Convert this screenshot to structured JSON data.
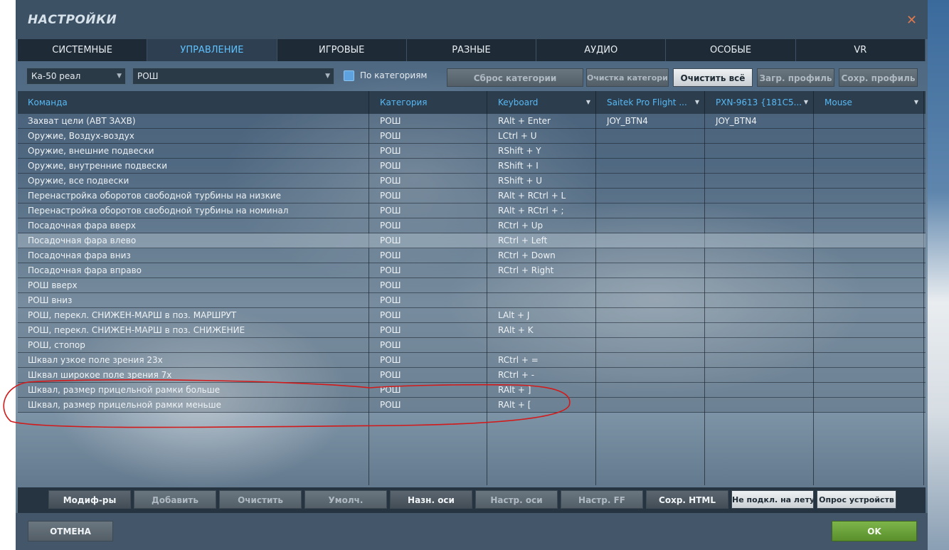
{
  "window": {
    "title": "НАСТРОЙКИ"
  },
  "tabs": [
    "СИСТЕМНЫЕ",
    "УПРАВЛЕНИЕ",
    "ИГРОВЫЕ",
    "РАЗНЫЕ",
    "АУДИО",
    "ОСОБЫЕ",
    "VR"
  ],
  "active_tab": "УПРАВЛЕНИЕ",
  "toolbar": {
    "aircraft_select": "Ка-50 реал",
    "category_select": "РОШ",
    "by_category_label": "По категориям",
    "by_category_checked": true,
    "reset_category": "Сброс категории",
    "clear_category": "Очистка категории",
    "clear_all": "Очистить всё",
    "load_profile": "Загр. профиль",
    "save_profile": "Сохр. профиль"
  },
  "table": {
    "columns": [
      "Команда",
      "Категория",
      "Keyboard",
      "Saitek Pro Flight ...",
      "PXN-9613 {181C5...",
      "Mouse"
    ],
    "rows": [
      {
        "command": "Захват цели (АВТ ЗАХВ)",
        "category": "РОШ",
        "keyboard": "RAlt + Enter",
        "saitek": "JOY_BTN4",
        "pxn": "JOY_BTN4",
        "mouse": ""
      },
      {
        "command": "Оружие, Воздух-воздух",
        "category": "РОШ",
        "keyboard": "LCtrl + U",
        "saitek": "",
        "pxn": "",
        "mouse": ""
      },
      {
        "command": "Оружие, внешние подвески",
        "category": "РОШ",
        "keyboard": "RShift + Y",
        "saitek": "",
        "pxn": "",
        "mouse": ""
      },
      {
        "command": "Оружие, внутренние подвески",
        "category": "РОШ",
        "keyboard": "RShift + I",
        "saitek": "",
        "pxn": "",
        "mouse": ""
      },
      {
        "command": "Оружие, все подвески",
        "category": "РОШ",
        "keyboard": "RShift + U",
        "saitek": "",
        "pxn": "",
        "mouse": ""
      },
      {
        "command": "Перенастройка оборотов свободной турбины на низкие",
        "category": "РОШ",
        "keyboard": "RAlt + RCtrl + L",
        "saitek": "",
        "pxn": "",
        "mouse": ""
      },
      {
        "command": "Перенастройка оборотов свободной турбины на номинал",
        "category": "РОШ",
        "keyboard": "RAlt + RCtrl + ;",
        "saitek": "",
        "pxn": "",
        "mouse": ""
      },
      {
        "command": "Посадочная фара вверх",
        "category": "РОШ",
        "keyboard": "RCtrl + Up",
        "saitek": "",
        "pxn": "",
        "mouse": ""
      },
      {
        "command": "Посадочная фара влево",
        "category": "РОШ",
        "keyboard": "RCtrl + Left",
        "saitek": "",
        "pxn": "",
        "mouse": ""
      },
      {
        "command": "Посадочная фара вниз",
        "category": "РОШ",
        "keyboard": "RCtrl + Down",
        "saitek": "",
        "pxn": "",
        "mouse": ""
      },
      {
        "command": "Посадочная фара вправо",
        "category": "РОШ",
        "keyboard": "RCtrl + Right",
        "saitek": "",
        "pxn": "",
        "mouse": ""
      },
      {
        "command": "РОШ вверх",
        "category": "РОШ",
        "keyboard": "",
        "saitek": "",
        "pxn": "",
        "mouse": ""
      },
      {
        "command": "РОШ вниз",
        "category": "РОШ",
        "keyboard": "",
        "saitek": "",
        "pxn": "",
        "mouse": ""
      },
      {
        "command": "РОШ, перекл. СНИЖЕН-МАРШ в поз. МАРШРУТ",
        "category": "РОШ",
        "keyboard": "LAlt + J",
        "saitek": "",
        "pxn": "",
        "mouse": ""
      },
      {
        "command": "РОШ, перекл. СНИЖЕН-МАРШ в поз. СНИЖЕНИЕ",
        "category": "РОШ",
        "keyboard": "RAlt + K",
        "saitek": "",
        "pxn": "",
        "mouse": ""
      },
      {
        "command": "РОШ, стопор",
        "category": "РОШ",
        "keyboard": "",
        "saitek": "",
        "pxn": "",
        "mouse": ""
      },
      {
        "command": "Шквал узкое поле зрения 23х",
        "category": "РОШ",
        "keyboard": "RCtrl + =",
        "saitek": "",
        "pxn": "",
        "mouse": ""
      },
      {
        "command": "Шквал широкое поле зрения 7х",
        "category": "РОШ",
        "keyboard": "RCtrl + -",
        "saitek": "",
        "pxn": "",
        "mouse": ""
      },
      {
        "command": "Шквал, размер прицельной рамки больше",
        "category": "РОШ",
        "keyboard": "RAlt + ]",
        "saitek": "",
        "pxn": "",
        "mouse": ""
      },
      {
        "command": "Шквал, размер прицельной рамки меньше",
        "category": "РОШ",
        "keyboard": "RAlt + [",
        "saitek": "",
        "pxn": "",
        "mouse": ""
      }
    ]
  },
  "bottom_buttons": [
    "Модиф-ры",
    "Добавить",
    "Очистить",
    "Умолч.",
    "Назн. оси",
    "Настр. оси",
    "Настр. FF",
    "Сохр. HTML",
    "Не подкл. на лету",
    "Опрос устройств"
  ],
  "footer": {
    "cancel": "ОТМЕНА",
    "ok": "OK"
  },
  "colors": {
    "accent": "#5fc2ff",
    "ok_green": "#6aa03a",
    "annotation_red": "#d21a1a",
    "close_orange": "#e0794e"
  }
}
